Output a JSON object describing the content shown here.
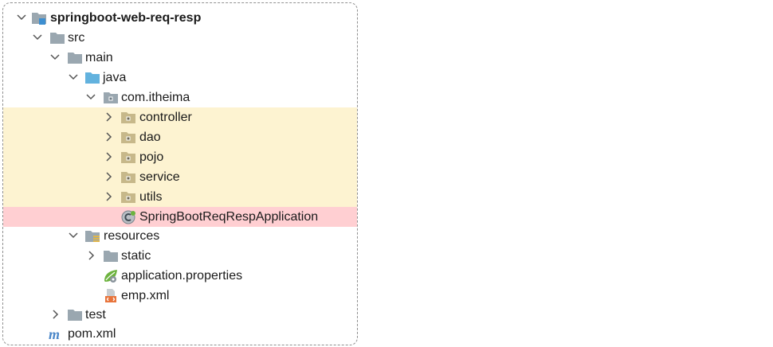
{
  "project_tree": {
    "root": {
      "label": "springboot-web-req-resp",
      "icon": "module-folder-icon",
      "expanded": true
    },
    "src": {
      "label": "src",
      "icon": "folder-icon",
      "expanded": true
    },
    "main": {
      "label": "main",
      "icon": "folder-icon",
      "expanded": true
    },
    "java": {
      "label": "java",
      "icon": "source-root-folder-icon",
      "expanded": true
    },
    "package": {
      "label": "com.itheima",
      "icon": "package-icon",
      "expanded": true
    },
    "subpackages": [
      {
        "label": "controller",
        "icon": "package-icon",
        "expanded": false
      },
      {
        "label": "dao",
        "icon": "package-icon",
        "expanded": false
      },
      {
        "label": "pojo",
        "icon": "package-icon",
        "expanded": false
      },
      {
        "label": "service",
        "icon": "package-icon",
        "expanded": false
      },
      {
        "label": "utils",
        "icon": "package-icon",
        "expanded": false
      }
    ],
    "application_class": {
      "label": "SpringBootReqRespApplication",
      "icon": "spring-boot-class-icon"
    },
    "resources": {
      "label": "resources",
      "icon": "resources-root-folder-icon",
      "expanded": true
    },
    "static": {
      "label": "static",
      "icon": "folder-icon",
      "expanded": false
    },
    "properties": {
      "label": "application.properties",
      "icon": "spring-properties-icon"
    },
    "emp_xml": {
      "label": "emp.xml",
      "icon": "xml-file-icon"
    },
    "test": {
      "label": "test",
      "icon": "folder-icon",
      "expanded": false
    },
    "pom": {
      "label": "pom.xml",
      "icon": "maven-icon"
    }
  },
  "colors": {
    "package_highlight": "#fdf3d1",
    "class_highlight": "#ffcfd2",
    "folder_gray": "#9aa7b0",
    "source_root_blue": "#62b2de",
    "package_tan": "#c7b88a",
    "spring_green": "#6db33f",
    "xml_orange": "#e8743b",
    "maven_blue": "#4a86c8"
  }
}
